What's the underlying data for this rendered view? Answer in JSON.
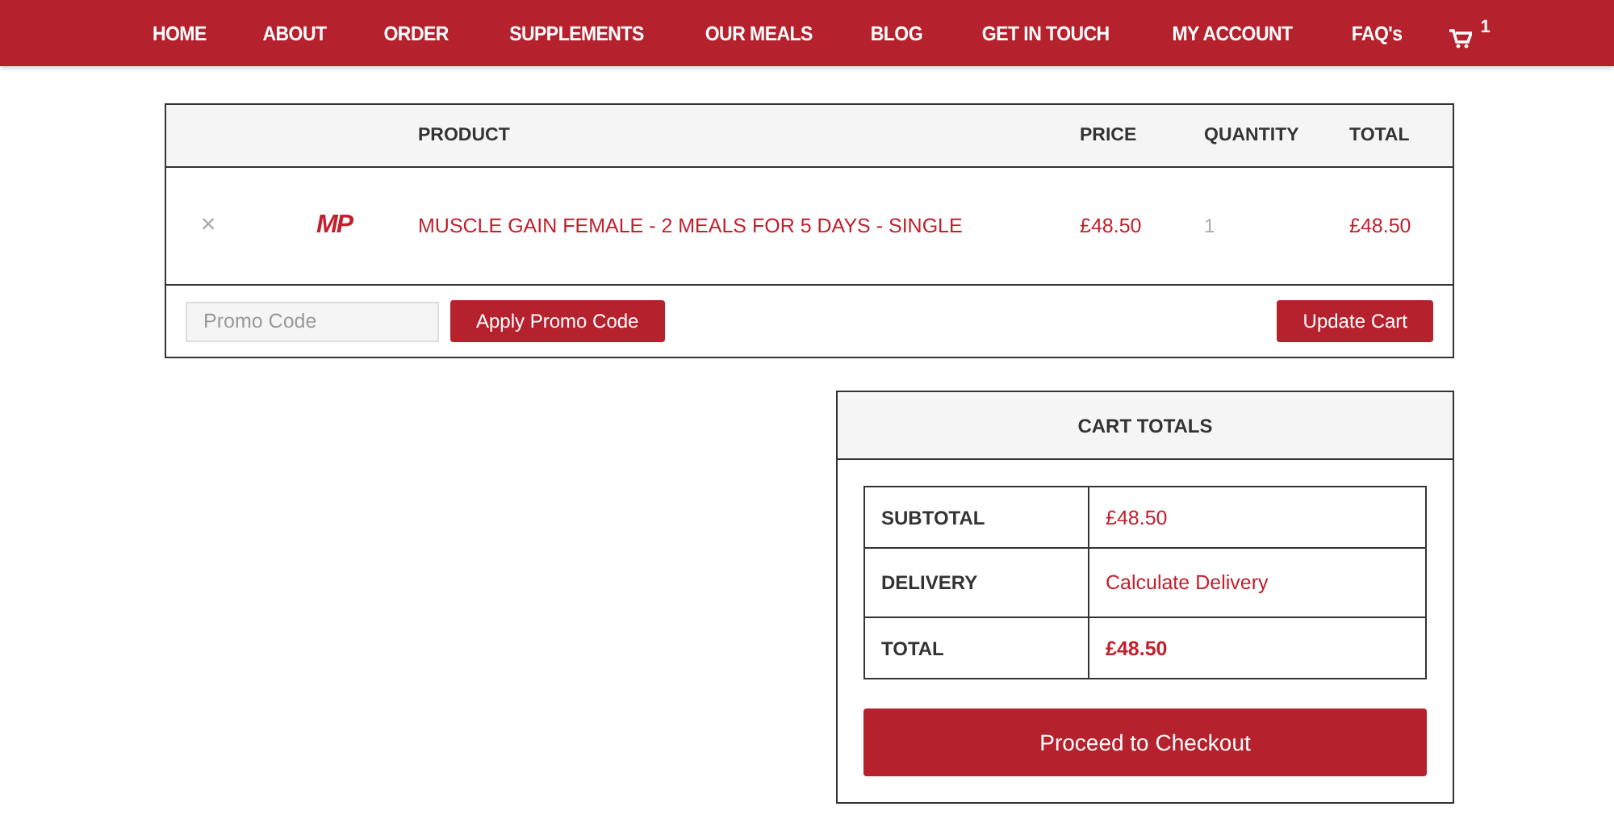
{
  "nav": {
    "items": [
      "HOME",
      "ABOUT",
      "ORDER",
      "SUPPLEMENTS",
      "OUR MEALS",
      "BLOG",
      "GET IN TOUCH",
      "MY ACCOUNT",
      "FAQ's"
    ],
    "cart_count": "1"
  },
  "cart": {
    "columns": [
      "PRODUCT",
      "PRICE",
      "QUANTITY",
      "TOTAL"
    ],
    "rows": [
      {
        "remove": "×",
        "logo": "MP",
        "product": "MUSCLE GAIN FEMALE - 2 MEALS FOR 5 DAYS - SINGLE",
        "price": "£48.50",
        "quantity": "1",
        "total": "£48.50"
      }
    ],
    "promo": {
      "placeholder": "Promo Code",
      "apply": "Apply Promo Code"
    },
    "update": "Update Cart"
  },
  "totals": {
    "title": "CART TOTALS",
    "rows": [
      {
        "label": "SUBTOTAL",
        "value": "£48.50",
        "kind": "amount"
      },
      {
        "label": "DELIVERY",
        "value": "Calculate Delivery",
        "kind": "link"
      },
      {
        "label": "TOTAL",
        "value": "£48.50",
        "kind": "strong"
      }
    ],
    "checkout": "Proceed to Checkout"
  }
}
